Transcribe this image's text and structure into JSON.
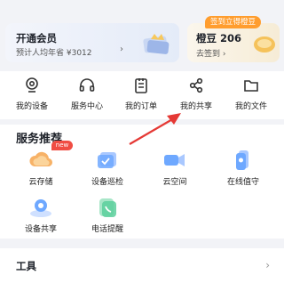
{
  "member": {
    "title": "开通会员",
    "subtitle": "预计人均年省 ¥3012",
    "chevron": "›"
  },
  "beans": {
    "label": "橙豆 206",
    "action": "去签到",
    "chevron": "›",
    "bubble": "签到立得橙豆"
  },
  "quick": [
    {
      "label": "我的设备",
      "icon": "camera-icon"
    },
    {
      "label": "服务中心",
      "icon": "headset-icon"
    },
    {
      "label": "我的订单",
      "icon": "order-list-icon"
    },
    {
      "label": "我的共享",
      "icon": "share-icon"
    },
    {
      "label": "我的文件",
      "icon": "folder-icon"
    }
  ],
  "services": {
    "title": "服务推荐",
    "new_badge": "new",
    "items": [
      {
        "label": "云存储",
        "icon": "cloud-storage-icon"
      },
      {
        "label": "设备巡检",
        "icon": "device-inspection-icon"
      },
      {
        "label": "云空间",
        "icon": "cloud-space-icon"
      },
      {
        "label": "在线值守",
        "icon": "online-guard-icon"
      },
      {
        "label": "设备共享",
        "icon": "device-share-icon"
      },
      {
        "label": "电话提醒",
        "icon": "phone-reminder-icon"
      }
    ]
  },
  "tools": {
    "title": "工具",
    "chevron": "›"
  },
  "colors": {
    "accent": "#ff9d2e",
    "badge": "#f04d43",
    "annotation_arrow": "#e53935",
    "service_blue": "#6ea8ff"
  }
}
